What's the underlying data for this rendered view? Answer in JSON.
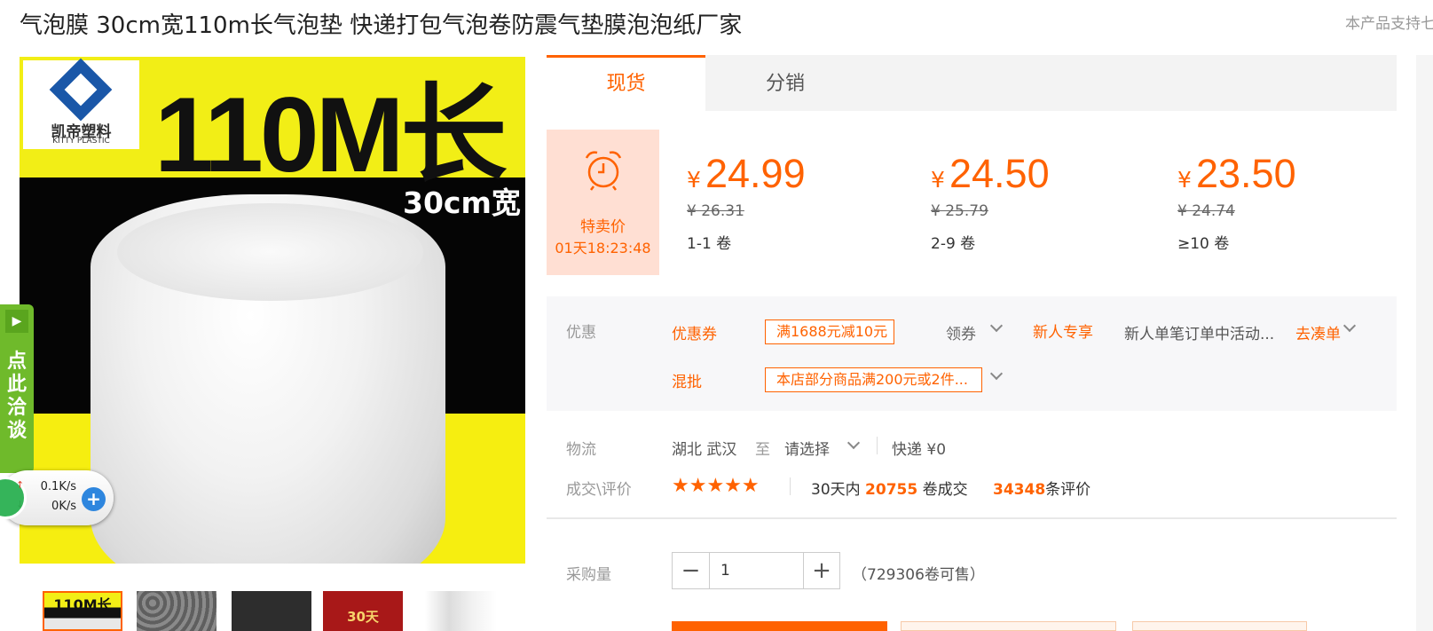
{
  "header": {
    "title": "气泡膜 30cm宽110m长气泡垫 快递打包气泡卷防震气垫膜泡泡纸厂家",
    "support_text": "本产品支持七"
  },
  "gallery": {
    "logo_cn": "凯帝塑料",
    "logo_en": "KITTY PLASTIC",
    "headline": "110M长",
    "width_text": "30cm宽",
    "thumbnails": [
      {
        "text": "110M长"
      },
      {
        "text": ""
      },
      {
        "text": ""
      },
      {
        "text": "30天"
      },
      {
        "text": ""
      }
    ]
  },
  "chat_widget": {
    "label": "点此洽谈"
  },
  "speed_widget": {
    "upload": "0.1K/s",
    "download": "0K/s",
    "up_arrow": "↑",
    "down_arrow": "↓",
    "plus": "+"
  },
  "tabs": [
    {
      "label": "现货"
    },
    {
      "label": "分销"
    }
  ],
  "sale": {
    "label": "特卖价",
    "timer": "01天18:23:48"
  },
  "prices": [
    {
      "currency": "¥",
      "now": "24.99",
      "old": "¥ 26.31",
      "range": "1-1 卷"
    },
    {
      "currency": "¥",
      "now": "24.50",
      "old": "¥ 25.79",
      "range": "2-9 卷"
    },
    {
      "currency": "¥",
      "now": "23.50",
      "old": "¥ 24.74",
      "range": "≥10 卷"
    }
  ],
  "promo": {
    "label": "优惠",
    "coupon_label": "优惠券",
    "coupon_value": "满1688元减10元",
    "claim_label": "领券",
    "newuser_label": "新人专享",
    "newuser_desc": "新人单笔订单中活动...",
    "makeup_label": "去凑单",
    "mix_label": "混批",
    "mix_value": "本店部分商品满200元或2件..."
  },
  "logistics": {
    "label": "物流",
    "origin": "湖北 武汉",
    "to": "至",
    "select": "请选择",
    "shipping": "快递 ¥0"
  },
  "reviews": {
    "label": "成交\\评价",
    "stars": "★★★★★",
    "period": "30天内",
    "deals": "20755",
    "deals_unit": "卷成交",
    "reviews": "34348",
    "reviews_unit": "条评价"
  },
  "purchase": {
    "label": "采购量",
    "qty": "1",
    "minus": "−",
    "plus": "+",
    "stock": "（729306卷可售）"
  },
  "colors": {
    "accent": "#ff6200",
    "sale_bg": "#ffdfd3",
    "promo_bg": "#f7f7f9",
    "chat_green": "#6fba2b"
  }
}
